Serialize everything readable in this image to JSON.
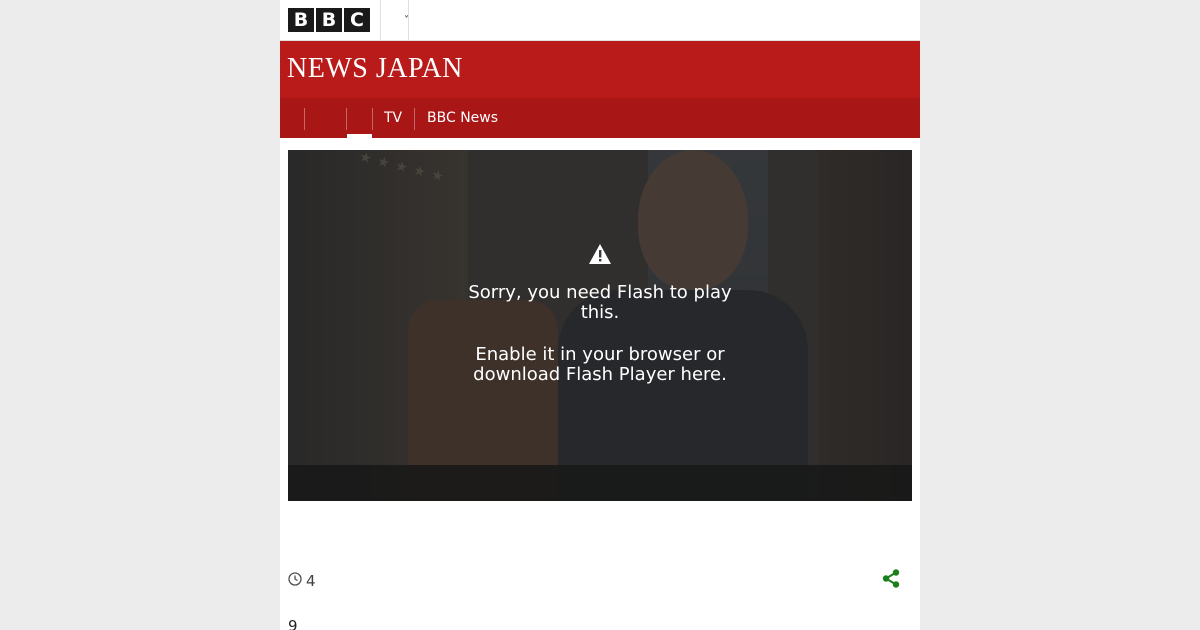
{
  "header": {
    "logo_letters": [
      "B",
      "B",
      "C"
    ],
    "menu_icon": "chevron-down-icon"
  },
  "masthead": {
    "title_bold": "NEWS",
    "title_light": "JAPAN"
  },
  "nav": {
    "items": [
      {
        "label": ""
      },
      {
        "label": ""
      },
      {
        "label": ""
      },
      {
        "label": "TV"
      },
      {
        "label": "BBC News"
      }
    ],
    "active_index": 2
  },
  "video": {
    "icon": "warning-icon",
    "message_line1": "Sorry, you need Flash to play this.",
    "message_line2": "Enable it in your browser or download Flash Player here."
  },
  "meta": {
    "clock_icon": "clock-icon",
    "time": "4",
    "share_icon": "share-icon",
    "share_color": "#1b7f1b"
  },
  "body": {
    "first_line": "9"
  },
  "colors": {
    "brand_red": "#b91a1a",
    "nav_red": "#a81616",
    "page_bg": "#ececec"
  }
}
